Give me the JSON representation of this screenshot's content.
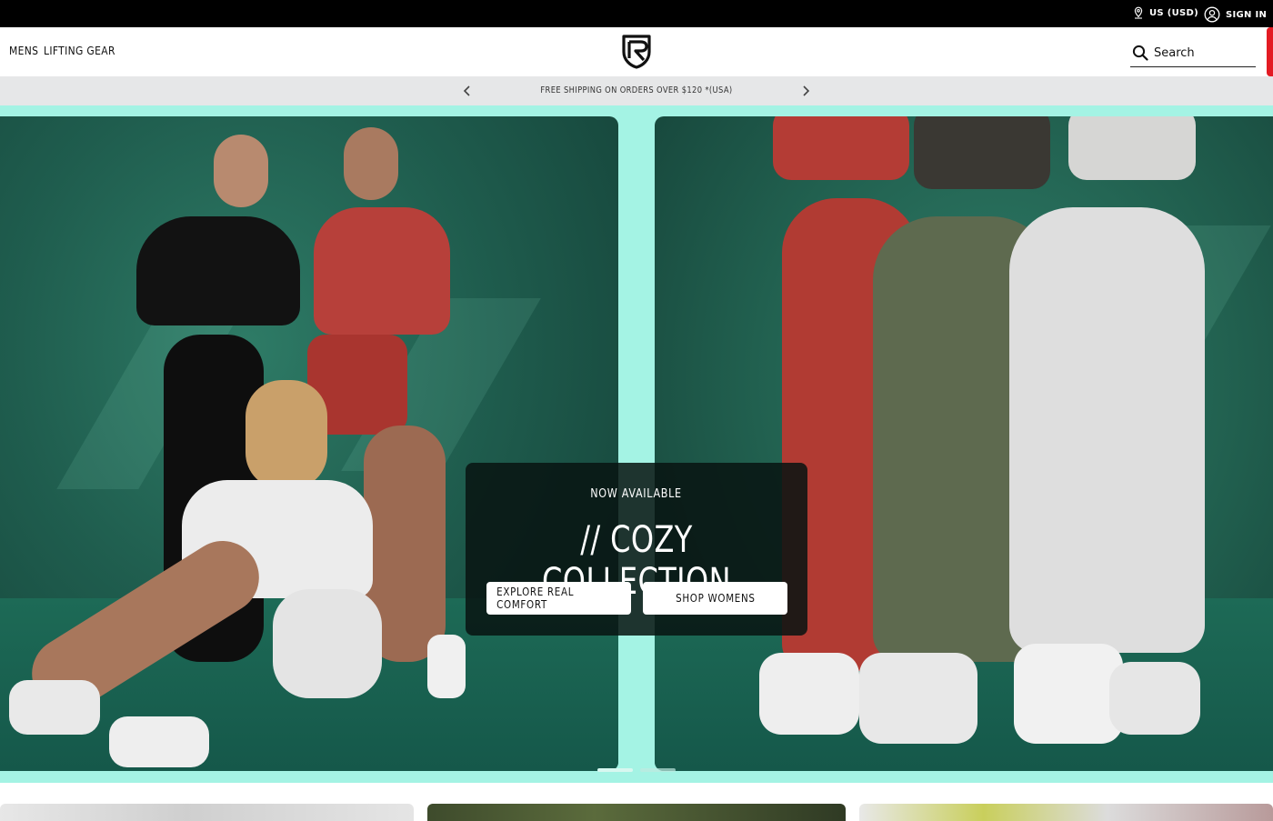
{
  "utility_bar": {
    "locale_label": "US (USD)",
    "signin_label": "SIGN IN"
  },
  "header": {
    "nav": [
      {
        "label": "MENS"
      },
      {
        "label": "LIFTING GEAR"
      }
    ],
    "search": {
      "placeholder": "Search",
      "value": ""
    }
  },
  "announcement": {
    "text": "FREE SHIPPING ON ORDERS OVER $120 *(USA)"
  },
  "hero": {
    "kicker": "NOW AVAILABLE",
    "title": "// COZY COLLECTION",
    "buttons": [
      {
        "label": "EXPLORE REAL COMFORT"
      },
      {
        "label": "SHOP WOMENS"
      }
    ],
    "slides_count": 2,
    "active_slide": 1
  },
  "colors": {
    "accent_mint": "#a4f3e4",
    "top_bar": "#000000",
    "announcement_bg": "#e6e7e8",
    "red_tab": "#e31b23",
    "hero_green": "#1f5d4e"
  },
  "icons": {
    "locale": "location-pin-icon",
    "signin": "user-circle-icon",
    "search": "search-icon",
    "prev": "chevron-left-icon",
    "next": "chevron-right-icon",
    "logo": "brand-logo-icon"
  }
}
